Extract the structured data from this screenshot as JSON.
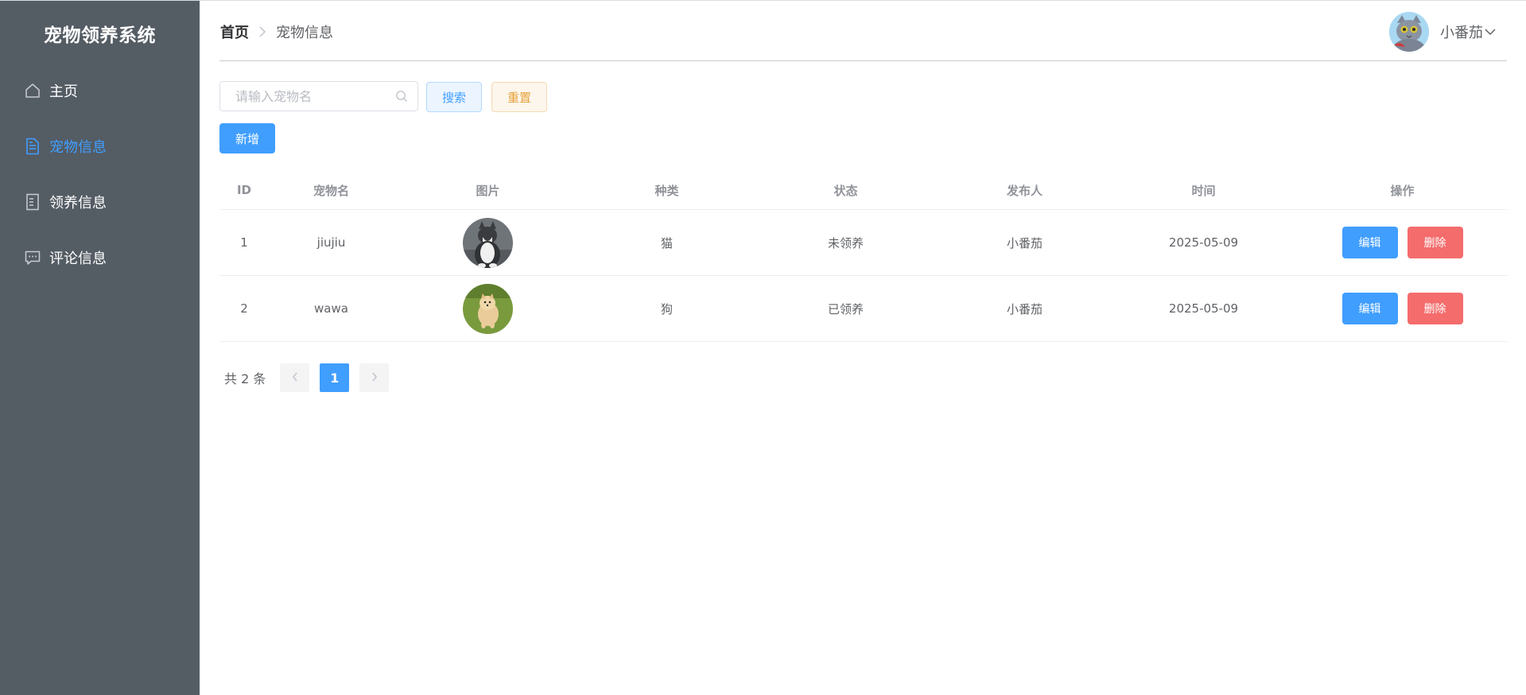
{
  "app": {
    "title": "宠物领养系统"
  },
  "sidebar": {
    "items": [
      {
        "label": "主页",
        "icon": "house-icon",
        "active": false
      },
      {
        "label": "宠物信息",
        "icon": "document-icon",
        "active": true
      },
      {
        "label": "领养信息",
        "icon": "tickets-icon",
        "active": false
      },
      {
        "label": "评论信息",
        "icon": "chat-icon",
        "active": false
      }
    ]
  },
  "header": {
    "breadcrumb": {
      "home": "首页",
      "current": "宠物信息"
    },
    "user": {
      "name": "小番茄"
    }
  },
  "toolbar": {
    "search_placeholder": "请输入宠物名",
    "search_value": "",
    "search_label": "搜索",
    "reset_label": "重置",
    "add_label": "新增"
  },
  "table": {
    "headers": {
      "id": "ID",
      "name": "宠物名",
      "img": "图片",
      "type": "种类",
      "status": "状态",
      "publisher": "发布人",
      "time": "时间",
      "ops": "操作"
    },
    "rows": [
      {
        "id": "1",
        "name": "jiujiu",
        "image": "cat-photo",
        "type": "猫",
        "status": "未领养",
        "publisher": "小番茄",
        "time": "2025-05-09",
        "edit": "编辑",
        "delete": "删除"
      },
      {
        "id": "2",
        "name": "wawa",
        "image": "dog-photo",
        "type": "狗",
        "status": "已领养",
        "publisher": "小番茄",
        "time": "2025-05-09",
        "edit": "编辑",
        "delete": "删除"
      }
    ]
  },
  "pagination": {
    "total_text": "共 2 条",
    "current_page": "1"
  },
  "colors": {
    "sidebar_bg": "#545c64",
    "primary": "#409eff",
    "danger": "#f56c6c",
    "warning": "#e6a23c"
  }
}
